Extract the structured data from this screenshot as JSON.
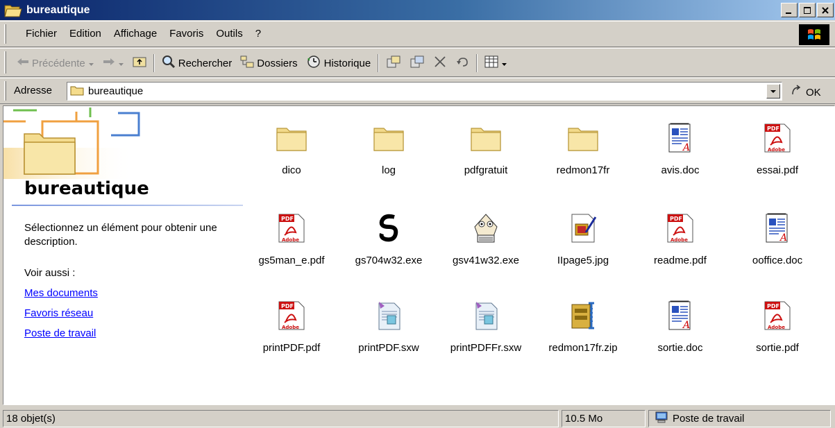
{
  "window": {
    "title": "bureautique",
    "controls": [
      "_",
      "□",
      "×"
    ]
  },
  "menu": {
    "items": [
      "Fichier",
      "Edition",
      "Affichage",
      "Favoris",
      "Outils",
      "?"
    ]
  },
  "toolbar": {
    "back_label": "Précédente",
    "search_label": "Rechercher",
    "folders_label": "Dossiers",
    "history_label": "Historique"
  },
  "address": {
    "label": "Adresse",
    "value": "bureautique",
    "go_label": "OK"
  },
  "leftpane": {
    "folder_title": "bureautique",
    "description": "Sélectionnez un élément pour obtenir une description.",
    "see_also": "Voir aussi :",
    "links": [
      "Mes documents",
      "Favoris réseau",
      "Poste de travail"
    ]
  },
  "files": [
    {
      "name": "dico",
      "icon": "folder-icon"
    },
    {
      "name": "log",
      "icon": "folder-icon"
    },
    {
      "name": "pdfgratuit",
      "icon": "folder-icon"
    },
    {
      "name": "redmon17fr",
      "icon": "folder-icon"
    },
    {
      "name": "avis.doc",
      "icon": "doc-icon"
    },
    {
      "name": "essai.pdf",
      "icon": "pdf-icon"
    },
    {
      "name": "gs5man_e.pdf",
      "icon": "pdf-icon"
    },
    {
      "name": "gs704w32.exe",
      "icon": "ghostscript-icon"
    },
    {
      "name": "gsv41w32.exe",
      "icon": "gsview-icon"
    },
    {
      "name": "IIpage5.jpg",
      "icon": "image-icon"
    },
    {
      "name": "readme.pdf",
      "icon": "pdf-icon"
    },
    {
      "name": "ooffice.doc",
      "icon": "doc-icon"
    },
    {
      "name": "printPDF.pdf",
      "icon": "pdf-icon"
    },
    {
      "name": "printPDF.sxw",
      "icon": "sxw-icon"
    },
    {
      "name": "printPDFFr.sxw",
      "icon": "sxw-icon"
    },
    {
      "name": "redmon17fr.zip",
      "icon": "zip-icon"
    },
    {
      "name": "sortie.doc",
      "icon": "doc-icon"
    },
    {
      "name": "sortie.pdf",
      "icon": "pdf-icon"
    }
  ],
  "status": {
    "count": "18 objet(s)",
    "size": "10.5 Mo",
    "zone": "Poste de travail"
  },
  "colors": {
    "titlebar_start": "#0a246a",
    "titlebar_end": "#a6caf0",
    "link": "#0000ff",
    "pdf_red": "#cc1111",
    "folder_yellow": "#f5dc8c"
  }
}
